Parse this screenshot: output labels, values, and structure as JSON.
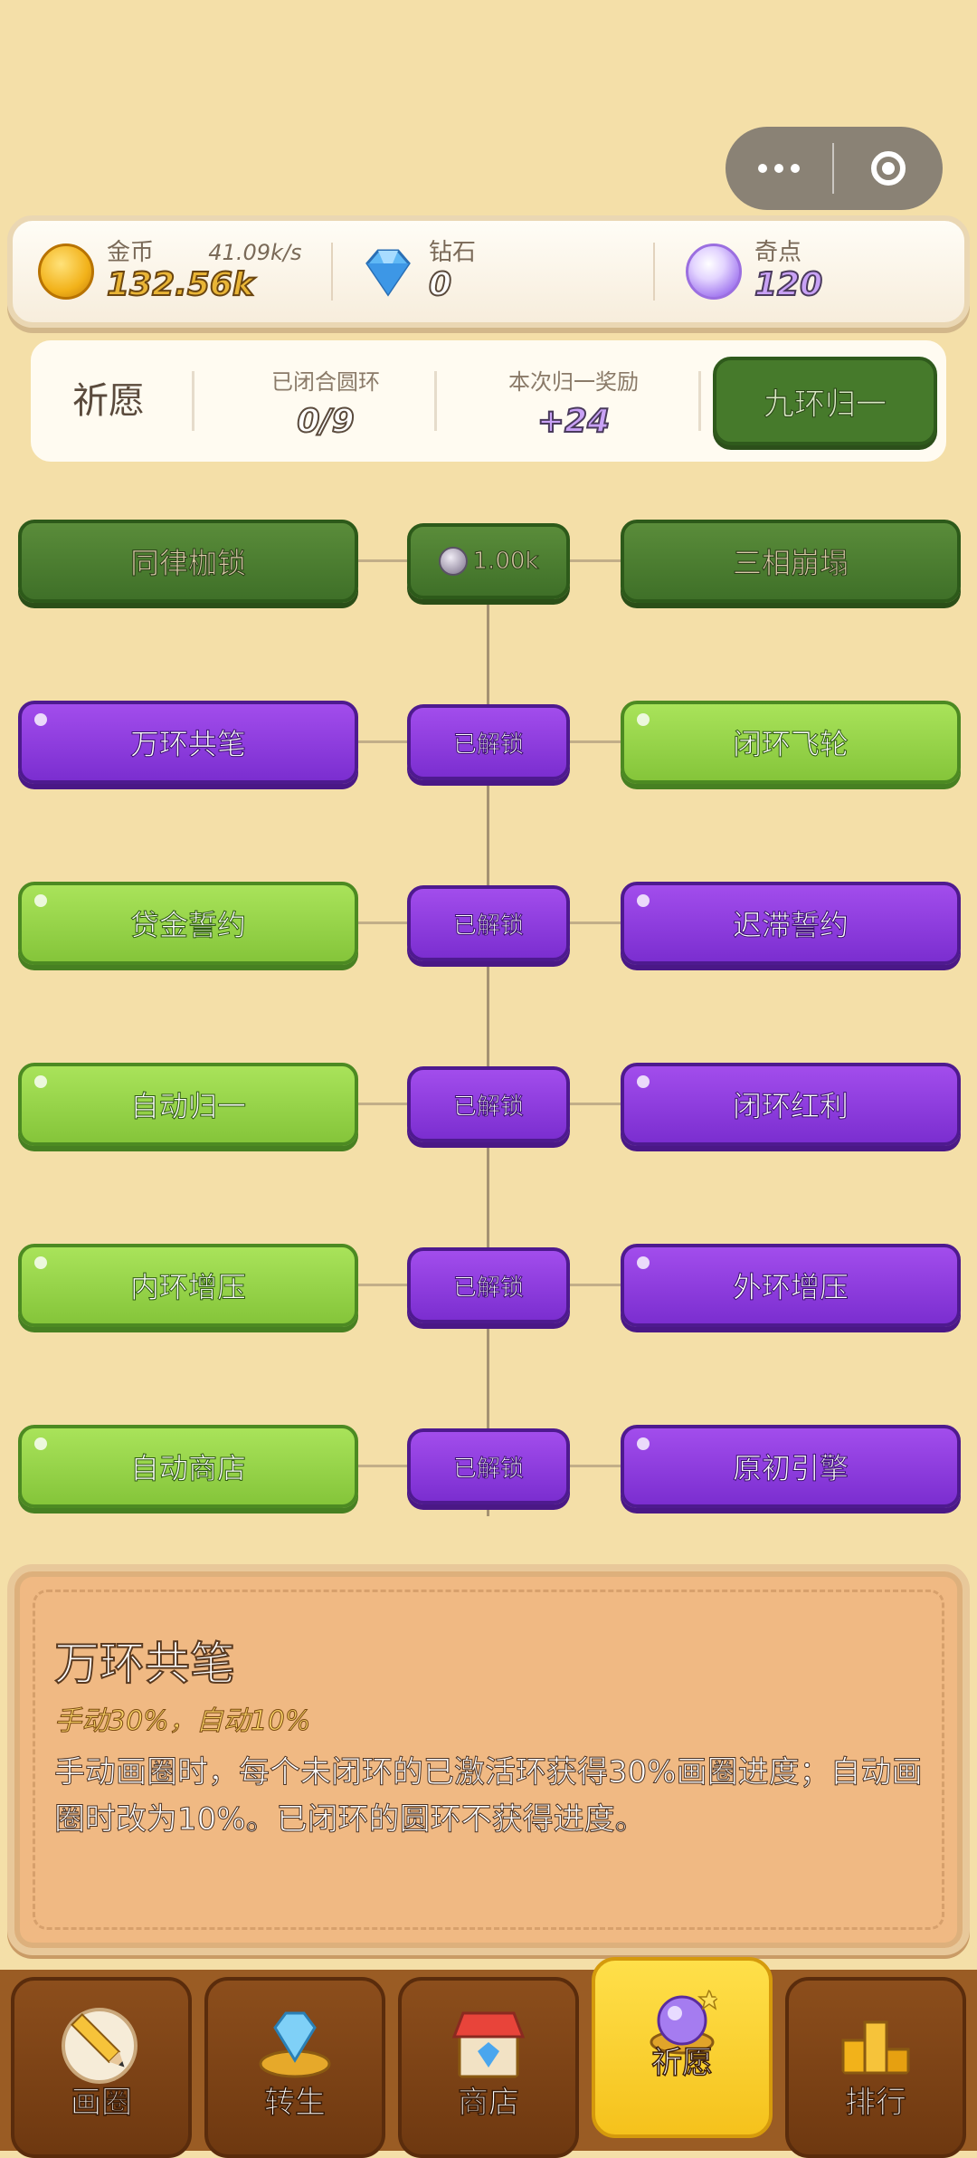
{
  "capsule": {
    "menu_icon": "more-dots-icon",
    "close_icon": "target-circle-icon"
  },
  "resources": {
    "coin": {
      "label": "金币",
      "rate": "41.09k/s",
      "value": "132.56k",
      "icon": "gold-coin-icon"
    },
    "diamond": {
      "label": "钻石",
      "value": "0",
      "icon": "diamond-icon"
    },
    "wish": {
      "label": "奇点",
      "value": "120",
      "icon": "purple-orb-icon"
    }
  },
  "info": {
    "title": "祈愿",
    "closed_label": "已闭合圆环",
    "closed_value": "0/9",
    "reward_label": "本次归一奖励",
    "reward_value": "+24",
    "button": "九环归一"
  },
  "tree": {
    "rows": [
      {
        "left": "同律枷锁",
        "left_state": "locked",
        "mid": "1.00k",
        "mid_state": "cost",
        "right": "三相崩塌",
        "right_state": "locked"
      },
      {
        "left": "万环共笔",
        "left_state": "selected",
        "mid": "已解锁",
        "mid_state": "unlocked",
        "right": "闭环飞轮",
        "right_state": "owned"
      },
      {
        "left": "贷金誓约",
        "left_state": "owned",
        "mid": "已解锁",
        "mid_state": "unlocked",
        "right": "迟滞誓约",
        "right_state": "selected"
      },
      {
        "left": "自动归一",
        "left_state": "owned",
        "mid": "已解锁",
        "mid_state": "unlocked",
        "right": "闭环红利",
        "right_state": "selected"
      },
      {
        "left": "内环增压",
        "left_state": "owned",
        "mid": "已解锁",
        "mid_state": "unlocked",
        "right": "外环增压",
        "right_state": "selected"
      },
      {
        "left": "自动商店",
        "left_state": "owned",
        "mid": "已解锁",
        "mid_state": "unlocked",
        "right": "原初引擎",
        "right_state": "selected"
      }
    ]
  },
  "detail": {
    "title": "万环共笔",
    "subtitle": "手动30%，自动10%",
    "body": "手动画圈时，每个未闭环的已激活环获得30%画圈进度；自动画圈时改为10%。已闭环的圆环不获得进度。"
  },
  "nav": {
    "tabs": [
      {
        "label": "画圈",
        "icon": "pencil-icon"
      },
      {
        "label": "转生",
        "icon": "crystal-ring-icon"
      },
      {
        "label": "商店",
        "icon": "shop-icon"
      },
      {
        "label": "祈愿",
        "icon": "wish-orb-icon",
        "active": true
      },
      {
        "label": "排行",
        "icon": "podium-icon"
      }
    ]
  }
}
